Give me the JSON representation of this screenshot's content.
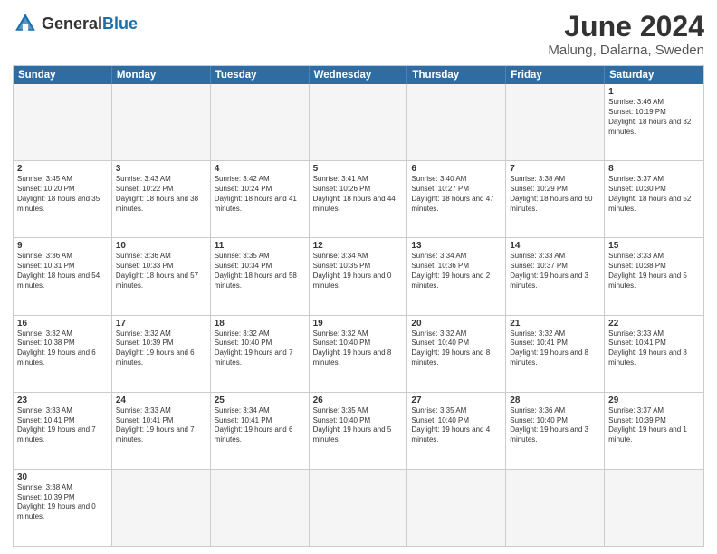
{
  "header": {
    "logo_general": "General",
    "logo_blue": "Blue",
    "month_title": "June 2024",
    "subtitle": "Malung, Dalarna, Sweden"
  },
  "weekdays": [
    "Sunday",
    "Monday",
    "Tuesday",
    "Wednesday",
    "Thursday",
    "Friday",
    "Saturday"
  ],
  "rows": [
    [
      {
        "day": "",
        "empty": true
      },
      {
        "day": "",
        "empty": true
      },
      {
        "day": "",
        "empty": true
      },
      {
        "day": "",
        "empty": true
      },
      {
        "day": "",
        "empty": true
      },
      {
        "day": "",
        "empty": true
      },
      {
        "day": "1",
        "sunrise": "Sunrise: 3:46 AM",
        "sunset": "Sunset: 10:19 PM",
        "daylight": "Daylight: 18 hours and 32 minutes."
      }
    ],
    [
      {
        "day": "2",
        "sunrise": "Sunrise: 3:45 AM",
        "sunset": "Sunset: 10:20 PM",
        "daylight": "Daylight: 18 hours and 35 minutes."
      },
      {
        "day": "3",
        "sunrise": "Sunrise: 3:43 AM",
        "sunset": "Sunset: 10:22 PM",
        "daylight": "Daylight: 18 hours and 38 minutes."
      },
      {
        "day": "4",
        "sunrise": "Sunrise: 3:42 AM",
        "sunset": "Sunset: 10:24 PM",
        "daylight": "Daylight: 18 hours and 41 minutes."
      },
      {
        "day": "5",
        "sunrise": "Sunrise: 3:41 AM",
        "sunset": "Sunset: 10:26 PM",
        "daylight": "Daylight: 18 hours and 44 minutes."
      },
      {
        "day": "6",
        "sunrise": "Sunrise: 3:40 AM",
        "sunset": "Sunset: 10:27 PM",
        "daylight": "Daylight: 18 hours and 47 minutes."
      },
      {
        "day": "7",
        "sunrise": "Sunrise: 3:38 AM",
        "sunset": "Sunset: 10:29 PM",
        "daylight": "Daylight: 18 hours and 50 minutes."
      },
      {
        "day": "8",
        "sunrise": "Sunrise: 3:37 AM",
        "sunset": "Sunset: 10:30 PM",
        "daylight": "Daylight: 18 hours and 52 minutes."
      }
    ],
    [
      {
        "day": "9",
        "sunrise": "Sunrise: 3:36 AM",
        "sunset": "Sunset: 10:31 PM",
        "daylight": "Daylight: 18 hours and 54 minutes."
      },
      {
        "day": "10",
        "sunrise": "Sunrise: 3:36 AM",
        "sunset": "Sunset: 10:33 PM",
        "daylight": "Daylight: 18 hours and 57 minutes."
      },
      {
        "day": "11",
        "sunrise": "Sunrise: 3:35 AM",
        "sunset": "Sunset: 10:34 PM",
        "daylight": "Daylight: 18 hours and 58 minutes."
      },
      {
        "day": "12",
        "sunrise": "Sunrise: 3:34 AM",
        "sunset": "Sunset: 10:35 PM",
        "daylight": "Daylight: 19 hours and 0 minutes."
      },
      {
        "day": "13",
        "sunrise": "Sunrise: 3:34 AM",
        "sunset": "Sunset: 10:36 PM",
        "daylight": "Daylight: 19 hours and 2 minutes."
      },
      {
        "day": "14",
        "sunrise": "Sunrise: 3:33 AM",
        "sunset": "Sunset: 10:37 PM",
        "daylight": "Daylight: 19 hours and 3 minutes."
      },
      {
        "day": "15",
        "sunrise": "Sunrise: 3:33 AM",
        "sunset": "Sunset: 10:38 PM",
        "daylight": "Daylight: 19 hours and 5 minutes."
      }
    ],
    [
      {
        "day": "16",
        "sunrise": "Sunrise: 3:32 AM",
        "sunset": "Sunset: 10:38 PM",
        "daylight": "Daylight: 19 hours and 6 minutes."
      },
      {
        "day": "17",
        "sunrise": "Sunrise: 3:32 AM",
        "sunset": "Sunset: 10:39 PM",
        "daylight": "Daylight: 19 hours and 6 minutes."
      },
      {
        "day": "18",
        "sunrise": "Sunrise: 3:32 AM",
        "sunset": "Sunset: 10:40 PM",
        "daylight": "Daylight: 19 hours and 7 minutes."
      },
      {
        "day": "19",
        "sunrise": "Sunrise: 3:32 AM",
        "sunset": "Sunset: 10:40 PM",
        "daylight": "Daylight: 19 hours and 8 minutes."
      },
      {
        "day": "20",
        "sunrise": "Sunrise: 3:32 AM",
        "sunset": "Sunset: 10:40 PM",
        "daylight": "Daylight: 19 hours and 8 minutes."
      },
      {
        "day": "21",
        "sunrise": "Sunrise: 3:32 AM",
        "sunset": "Sunset: 10:41 PM",
        "daylight": "Daylight: 19 hours and 8 minutes."
      },
      {
        "day": "22",
        "sunrise": "Sunrise: 3:33 AM",
        "sunset": "Sunset: 10:41 PM",
        "daylight": "Daylight: 19 hours and 8 minutes."
      }
    ],
    [
      {
        "day": "23",
        "sunrise": "Sunrise: 3:33 AM",
        "sunset": "Sunset: 10:41 PM",
        "daylight": "Daylight: 19 hours and 7 minutes."
      },
      {
        "day": "24",
        "sunrise": "Sunrise: 3:33 AM",
        "sunset": "Sunset: 10:41 PM",
        "daylight": "Daylight: 19 hours and 7 minutes."
      },
      {
        "day": "25",
        "sunrise": "Sunrise: 3:34 AM",
        "sunset": "Sunset: 10:41 PM",
        "daylight": "Daylight: 19 hours and 6 minutes."
      },
      {
        "day": "26",
        "sunrise": "Sunrise: 3:35 AM",
        "sunset": "Sunset: 10:40 PM",
        "daylight": "Daylight: 19 hours and 5 minutes."
      },
      {
        "day": "27",
        "sunrise": "Sunrise: 3:35 AM",
        "sunset": "Sunset: 10:40 PM",
        "daylight": "Daylight: 19 hours and 4 minutes."
      },
      {
        "day": "28",
        "sunrise": "Sunrise: 3:36 AM",
        "sunset": "Sunset: 10:40 PM",
        "daylight": "Daylight: 19 hours and 3 minutes."
      },
      {
        "day": "29",
        "sunrise": "Sunrise: 3:37 AM",
        "sunset": "Sunset: 10:39 PM",
        "daylight": "Daylight: 19 hours and 1 minute."
      }
    ],
    [
      {
        "day": "30",
        "sunrise": "Sunrise: 3:38 AM",
        "sunset": "Sunset: 10:39 PM",
        "daylight": "Daylight: 19 hours and 0 minutes."
      },
      {
        "day": "",
        "empty": true
      },
      {
        "day": "",
        "empty": true
      },
      {
        "day": "",
        "empty": true
      },
      {
        "day": "",
        "empty": true
      },
      {
        "day": "",
        "empty": true
      },
      {
        "day": "",
        "empty": true
      }
    ]
  ]
}
